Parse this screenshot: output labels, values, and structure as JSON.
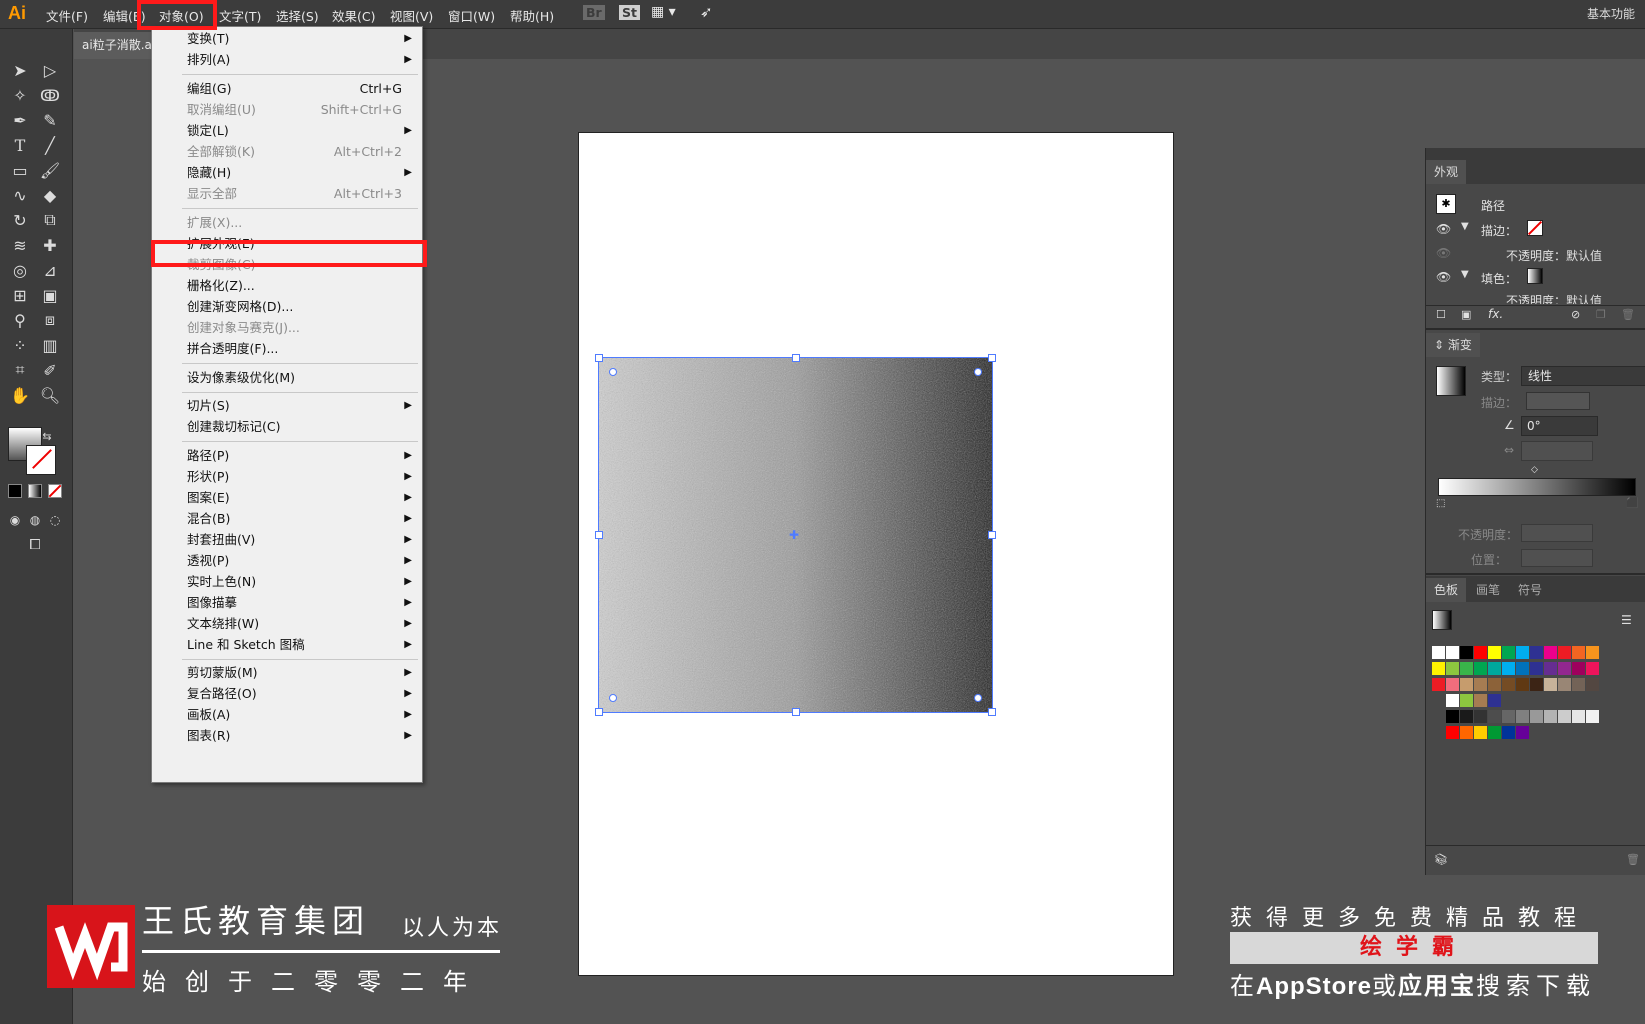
{
  "app": {
    "logo": "Ai",
    "workspace": "基本功能"
  },
  "menubar": {
    "items": [
      "文件(F)",
      "编辑(E)",
      "对象(O)",
      "文字(T)",
      "选择(S)",
      "效果(C)",
      "视图(V)",
      "窗口(W)",
      "帮助(H)"
    ],
    "extras": [
      "Br",
      "St"
    ]
  },
  "document": {
    "tab_title": "ai粒子消散.ai"
  },
  "object_menu": {
    "items": [
      {
        "label": "变换(T)",
        "submenu": true
      },
      {
        "label": "排列(A)",
        "submenu": true
      },
      {
        "label": "编组(G)",
        "shortcut": "Ctrl+G"
      },
      {
        "label": "取消编组(U)",
        "shortcut": "Shift+Ctrl+G",
        "disabled": true
      },
      {
        "label": "锁定(L)",
        "submenu": true
      },
      {
        "label": "全部解锁(K)",
        "shortcut": "Alt+Ctrl+2",
        "disabled": true
      },
      {
        "label": "隐藏(H)",
        "submenu": true
      },
      {
        "label": "显示全部",
        "shortcut": "Alt+Ctrl+3",
        "disabled": true
      },
      {
        "label": "扩展(X)...",
        "disabled": true
      },
      {
        "label": "扩展外观(E)",
        "highlighted": true
      },
      {
        "label": "裁剪图像(C)",
        "disabled": true
      },
      {
        "label": "栅格化(Z)..."
      },
      {
        "label": "创建渐变网格(D)..."
      },
      {
        "label": "创建对象马赛克(J)...",
        "disabled": true
      },
      {
        "label": "拼合透明度(F)..."
      },
      {
        "label": "设为像素级优化(M)"
      },
      {
        "label": "切片(S)",
        "submenu": true
      },
      {
        "label": "创建裁切标记(C)"
      },
      {
        "label": "路径(P)",
        "submenu": true
      },
      {
        "label": "形状(P)",
        "submenu": true
      },
      {
        "label": "图案(E)",
        "submenu": true
      },
      {
        "label": "混合(B)",
        "submenu": true
      },
      {
        "label": "封套扭曲(V)",
        "submenu": true
      },
      {
        "label": "透视(P)",
        "submenu": true
      },
      {
        "label": "实时上色(N)",
        "submenu": true
      },
      {
        "label": "图像描摹",
        "submenu": true
      },
      {
        "label": "文本绕排(W)",
        "submenu": true
      },
      {
        "label": "Line 和 Sketch 图稿",
        "submenu": true
      },
      {
        "label": "剪切蒙版(M)",
        "submenu": true
      },
      {
        "label": "复合路径(O)",
        "submenu": true
      },
      {
        "label": "画板(A)",
        "submenu": true
      },
      {
        "label": "图表(R)",
        "submenu": true
      }
    ]
  },
  "appearance_panel": {
    "tab": "外观",
    "object": "路径",
    "stroke_label": "描边：",
    "opacity_label": "不透明度：默认值",
    "fill_label": "填色：",
    "opacity_label2": "不透明度：默认值",
    "fx": "fx."
  },
  "gradient_panel": {
    "tab": "渐变",
    "type_label": "类型：",
    "type_value": "线性",
    "stroke_label": "描边：",
    "angle_value": "0°",
    "opacity_label": "不透明度：",
    "position_label": "位置："
  },
  "swatches_panel": {
    "tabs": [
      "色板",
      "画笔",
      "符号"
    ]
  },
  "watermark": {
    "title": "王氏教育集团",
    "slogan": "以人为本",
    "since": "始创于二零零二年",
    "right_line1": "获得更多免费精品教程",
    "right_banner": "绘学霸",
    "right_line3_a": "在",
    "right_line3_b": "AppStore",
    "right_line3_c": "或",
    "right_line3_d": "应用宝",
    "right_line3_e": "搜索下载"
  },
  "colors": {
    "highlight_red": "#ff1a1a",
    "selection_blue": "#4f7bff",
    "brand_red": "#d8141a"
  }
}
